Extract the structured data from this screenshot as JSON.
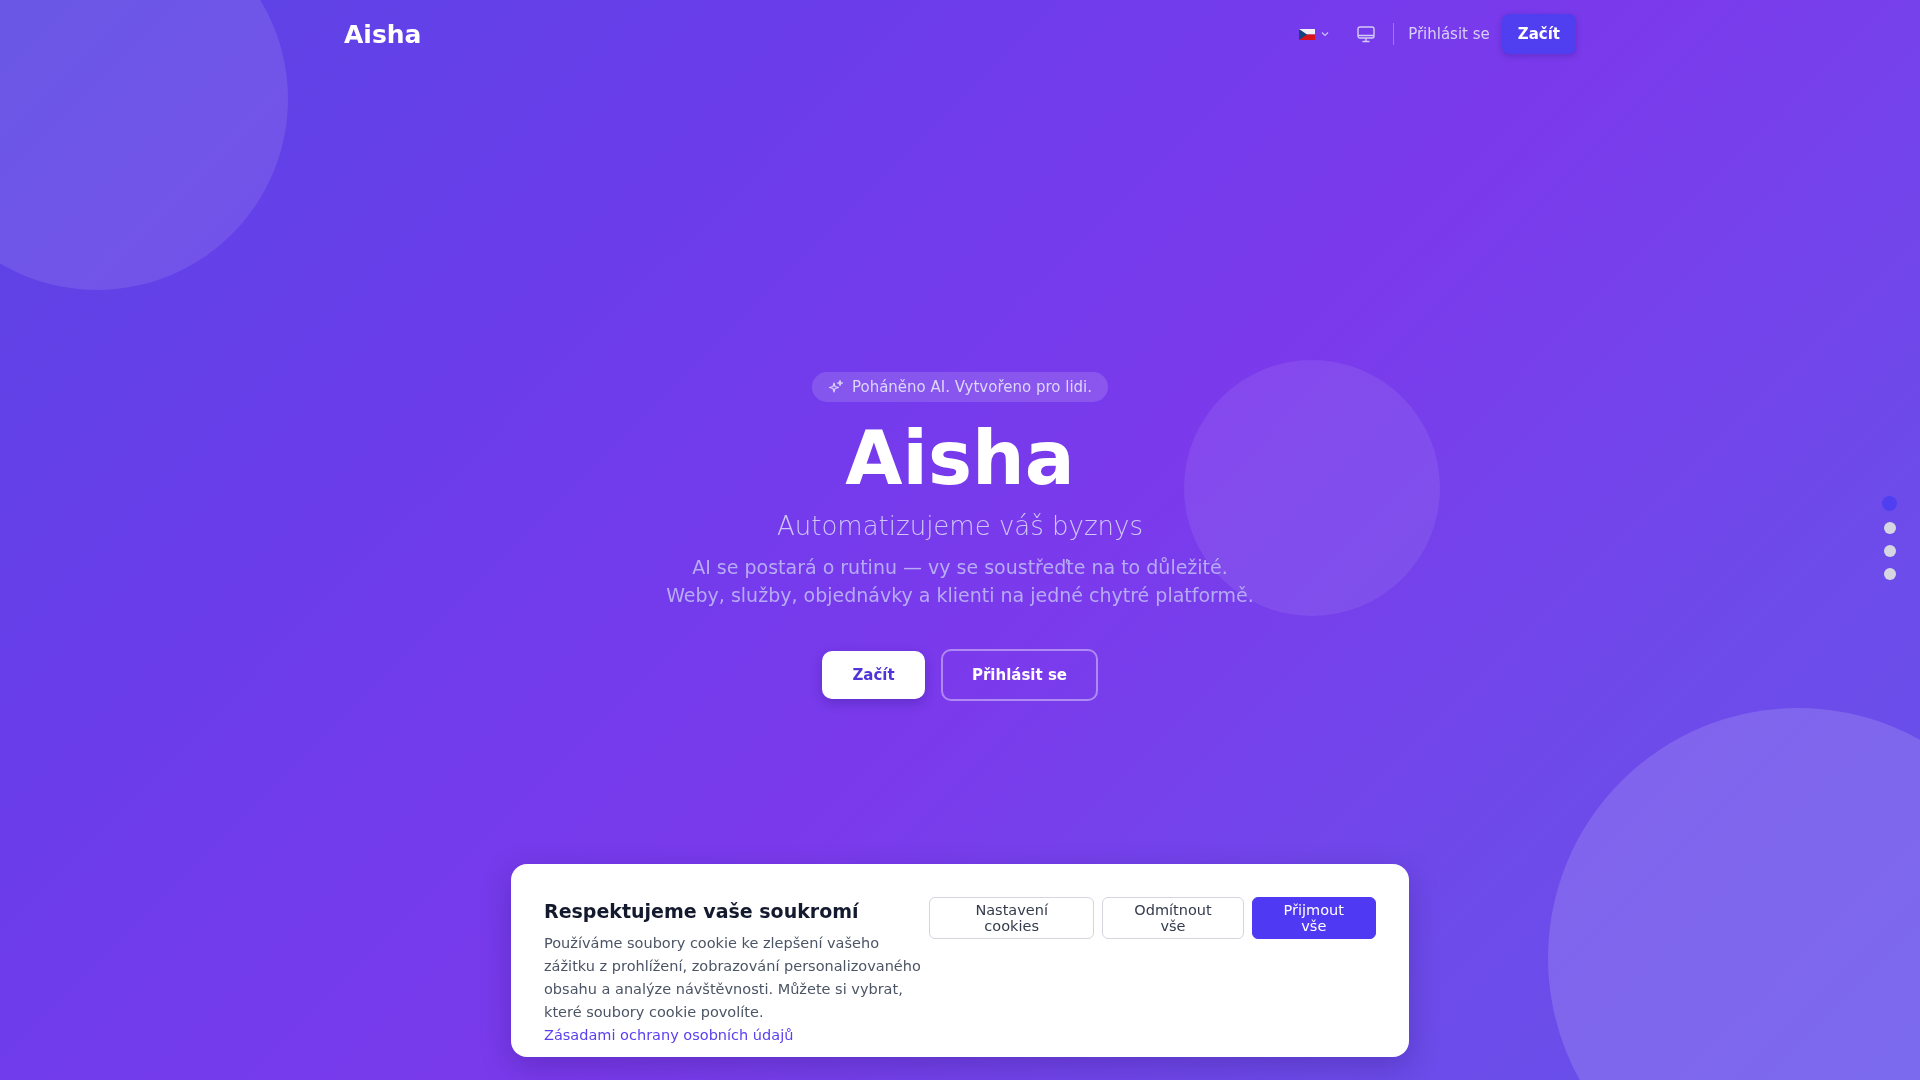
{
  "header": {
    "logo": "Aisha",
    "login_link": "Přihlásit se",
    "start_button": "Začít"
  },
  "hero": {
    "badge": "Poháněno AI. Vytvořeno pro lidi.",
    "title": "Aisha",
    "subtitle": "Automatizujeme váš byznys",
    "description": "AI se postará o rutinu — vy se soustřeďte na to důležité. Weby, služby, objednávky a klienti na jedné chytré platformě.",
    "buttons": [
      {
        "label": "Začít",
        "kind": "primary"
      },
      {
        "label": "Přihlásit se",
        "kind": "outline"
      }
    ]
  },
  "slide_dots": [
    {
      "selected": true
    },
    {
      "selected": false
    },
    {
      "selected": false
    },
    {
      "selected": false
    }
  ],
  "cookie_banner": {
    "title": "Respektujeme vaše soukromí",
    "text": "Používáme soubory cookie ke zlepšení vašeho zážitku z prohlížení, zobrazování personalizovaného obsahu a analýze návštěvnosti. Můžete si vybrat, které soubory cookie povolíte.",
    "link": "Zásadami ochrany osobních údajů",
    "buttons": [
      {
        "label": "Nastavení cookies",
        "kind": "secondary"
      },
      {
        "label": "Odmítnout vše",
        "kind": "secondary"
      },
      {
        "label": "Přijmout vše",
        "kind": "primary"
      }
    ]
  }
}
